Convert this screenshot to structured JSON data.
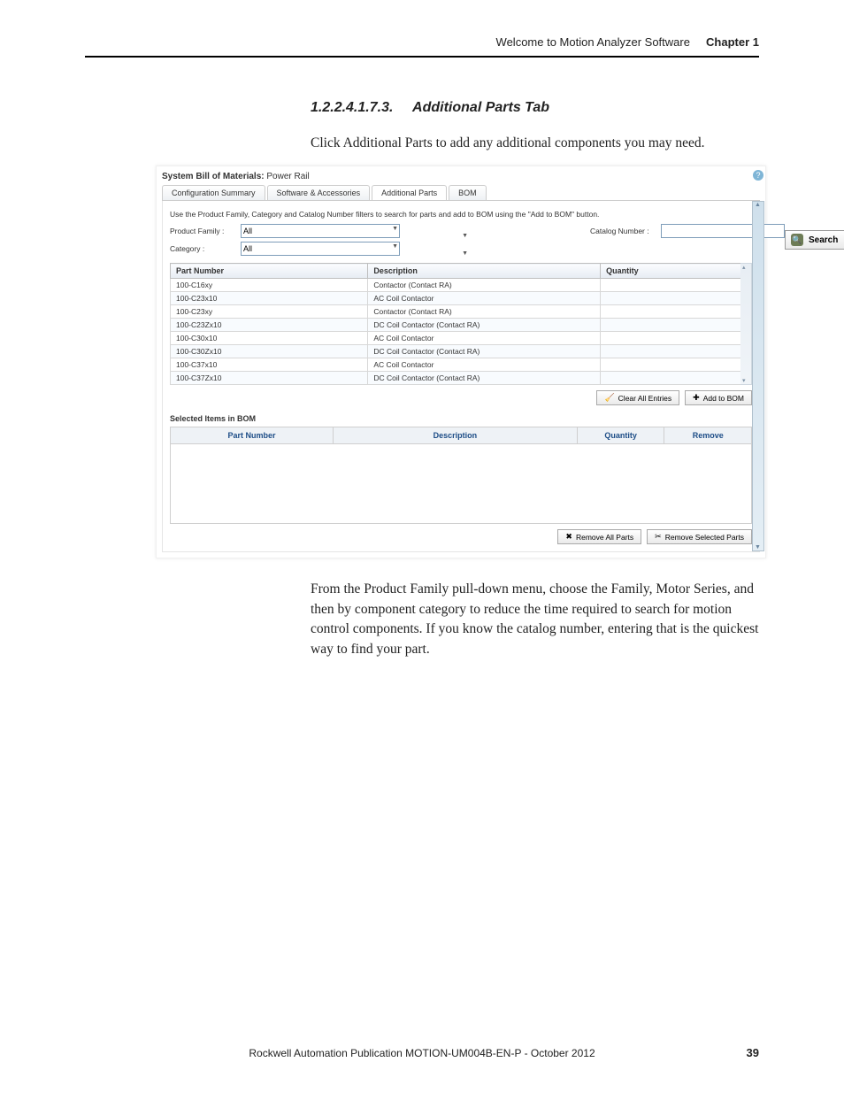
{
  "header": {
    "left": "Welcome to Motion Analyzer Software",
    "chapter": "Chapter 1"
  },
  "section": {
    "number": "1.2.2.4.1.7.3.",
    "title": "Additional Parts Tab"
  },
  "para1": "Click Additional Parts to add any additional components you may need.",
  "para2": "From the Product Family pull-down menu, choose the Family, Motor Series, and then by component category to reduce the time required to search for motion control components. If you know the catalog number, entering that is the quickest way to find your part.",
  "footer": {
    "pub": "Rockwell Automation Publication MOTION-UM004B-EN-P - October 2012",
    "page": "39"
  },
  "shot": {
    "title_bold": "System Bill of Materials:",
    "title_rest": " Power Rail",
    "tabs": [
      "Configuration Summary",
      "Software & Accessories",
      "Additional Parts",
      "BOM"
    ],
    "active_tab": 2,
    "instruction": "Use the Product Family, Category and Catalog Number filters to search for parts and add to BOM using the \"Add to BOM\" button.",
    "labels": {
      "product_family": "Product Family :",
      "category": "Category :",
      "catalog_number": "Catalog Number :"
    },
    "values": {
      "product_family": "All",
      "category": "All",
      "catalog_number": ""
    },
    "search": "Search",
    "columns": [
      "Part Number",
      "Description",
      "Quantity"
    ],
    "rows": [
      {
        "pn": "100-C16xy",
        "desc": "Contactor (Contact RA)",
        "qty": ""
      },
      {
        "pn": "100-C23x10",
        "desc": "AC Coil Contactor",
        "qty": ""
      },
      {
        "pn": "100-C23xy",
        "desc": "Contactor (Contact RA)",
        "qty": ""
      },
      {
        "pn": "100-C23Zx10",
        "desc": "DC Coil Contactor (Contact RA)",
        "qty": ""
      },
      {
        "pn": "100-C30x10",
        "desc": "AC Coil Contactor",
        "qty": ""
      },
      {
        "pn": "100-C30Zx10",
        "desc": "DC Coil Contactor (Contact RA)",
        "qty": ""
      },
      {
        "pn": "100-C37x10",
        "desc": "AC Coil Contactor",
        "qty": ""
      },
      {
        "pn": "100-C37Zx10",
        "desc": "DC Coil Contactor (Contact RA)",
        "qty": ""
      }
    ],
    "buttons": {
      "clear": "Clear All Entries",
      "add": "Add to BOM",
      "remove_all": "Remove All Parts",
      "remove_sel": "Remove Selected Parts"
    },
    "selected_title": "Selected Items in BOM",
    "sel_columns": [
      "Part Number",
      "Description",
      "Quantity",
      "Remove"
    ]
  }
}
